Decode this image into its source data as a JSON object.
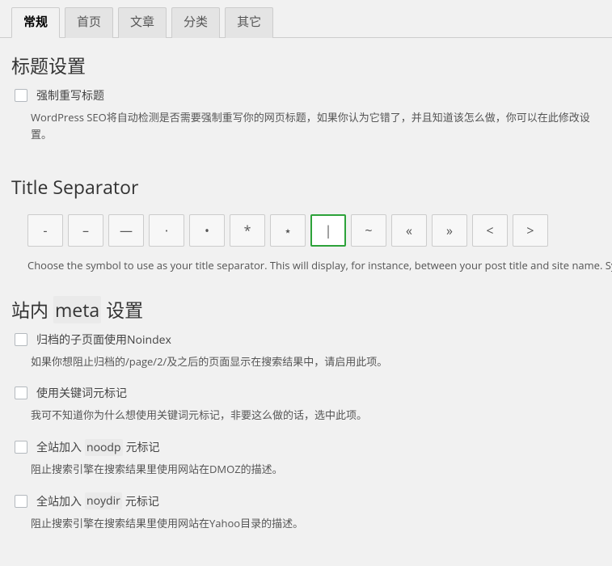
{
  "tabs": {
    "items": [
      "常规",
      "首页",
      "文章",
      "分类",
      "其它"
    ],
    "active_index": 0
  },
  "title_section": {
    "heading": "标题设置",
    "force_rewrite": {
      "label": "强制重写标题",
      "desc": "WordPress SEO将自动检测是否需要强制重写你的网页标题，如果你认为它错了，并且知道该怎么做，你可以在此修改设置。"
    }
  },
  "separator_section": {
    "heading": "Title Separator",
    "options": [
      "-",
      "–",
      "—",
      "·",
      "•",
      "*",
      "⋆",
      "|",
      "~",
      "«",
      "»",
      "<",
      ">"
    ],
    "selected_index": 7,
    "help": "Choose the symbol to use as your title separator. This will display, for instance, between your post title and site name. Symbols are shown in the size they'll appear in."
  },
  "meta_section": {
    "heading_pre": "站内",
    "heading_code": "meta",
    "heading_post": "设置",
    "items": [
      {
        "label": "归档的子页面使用Noindex",
        "desc": "如果你想阻止归档的/page/2/及之后的页面显示在搜索结果中，请启用此项。"
      },
      {
        "label": "使用关键词元标记",
        "desc": "我可不知道你为什么想使用关键词元标记，非要这么做的话，选中此项。"
      },
      {
        "label_pre": "全站加入",
        "label_code": "noodp",
        "label_post": "元标记",
        "desc": "阻止搜索引擎在搜索结果里使用网站在DMOZ的描述。"
      },
      {
        "label_pre": "全站加入",
        "label_code": "noydir",
        "label_post": "元标记",
        "desc": "阻止搜索引擎在搜索结果里使用网站在Yahoo目录的描述。"
      }
    ]
  }
}
